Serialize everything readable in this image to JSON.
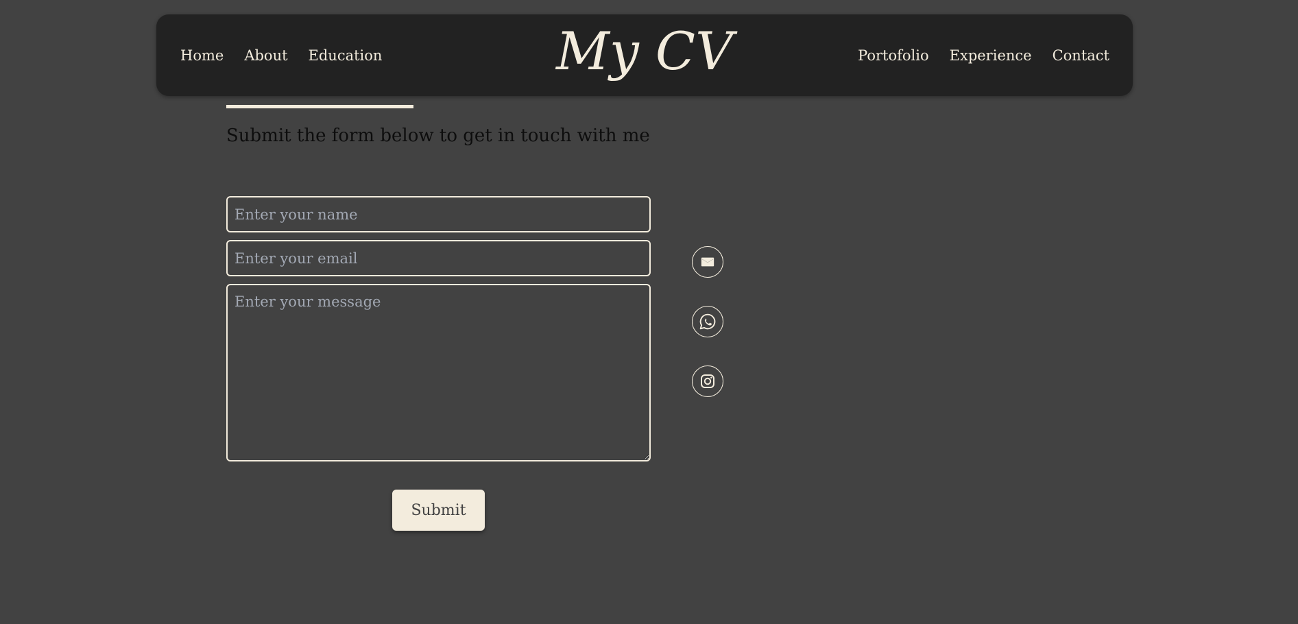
{
  "nav": {
    "brand": "My CV",
    "left_links": [
      "Home",
      "About",
      "Education"
    ],
    "right_links": [
      "Portofolio",
      "Experience",
      "Contact"
    ]
  },
  "contact": {
    "subtitle": "Submit the form below to get in touch with me",
    "name_placeholder": "Enter your name",
    "email_placeholder": "Enter your email",
    "message_placeholder": "Enter your message",
    "submit_label": "Submit"
  },
  "social": [
    "email-icon",
    "whatsapp-icon",
    "instagram-icon"
  ],
  "colors": {
    "background": "#424242",
    "navbar": "#222222",
    "accent": "#f3ecdd",
    "placeholder": "#a3a9b4"
  }
}
